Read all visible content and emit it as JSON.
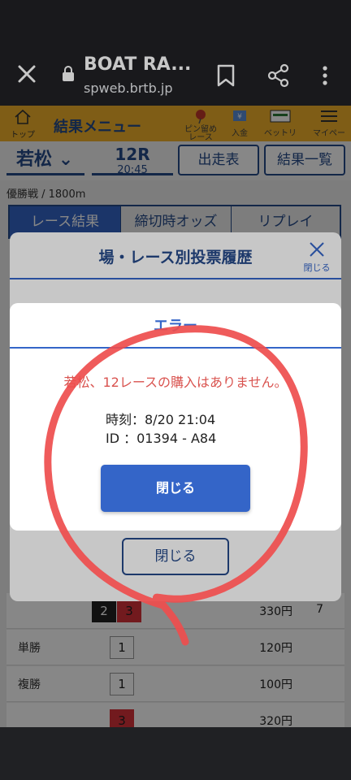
{
  "browser": {
    "title": "BOAT RA...",
    "domain": "spweb.brtb.jp"
  },
  "header": {
    "home_label": "トップ",
    "menu_title": "結果メニュー",
    "items": [
      {
        "label": "ピン留め\nレース",
        "icon": "pin-icon"
      },
      {
        "label": "入金",
        "icon": "deposit-icon"
      },
      {
        "label": "ベットリスト",
        "icon": "betlist-icon"
      },
      {
        "label": "マイページ",
        "icon": "menu-icon"
      }
    ]
  },
  "venue": {
    "name": "若松",
    "race": "12R",
    "time": "20:45",
    "tabs": [
      "出走表",
      "結果一覧"
    ]
  },
  "race_info": "優勝戦 / 1800m",
  "result_tabs": [
    "レース結果",
    "締切時オッズ",
    "リプレイ"
  ],
  "results": [
    {
      "label": "",
      "boats": [
        "2",
        "3"
      ],
      "amount": "330円",
      "popularity": "7"
    },
    {
      "label": "単勝",
      "boats": [
        "1"
      ],
      "amount": "120円",
      "popularity": ""
    },
    {
      "label": "複勝",
      "boats": [
        "1"
      ],
      "amount": "100円",
      "popularity": ""
    },
    {
      "label": "",
      "boats": [
        "3"
      ],
      "amount": "320円",
      "popularity": ""
    }
  ],
  "history_modal": {
    "title": "場・レース別投票履歴",
    "close_label": "閉じる",
    "bottom_button": "閉じる"
  },
  "error_modal": {
    "title": "エラー",
    "message": "若松、12レースの購入はありません。",
    "time_line": "時刻：8/20 21:04",
    "id_line": "ID ：01394 - A84",
    "button": "閉じる"
  },
  "colors": {
    "brand_blue": "#264a8a",
    "accent_blue": "#3465c8",
    "header_orange": "#f1b22b",
    "error_red": "#d9534f",
    "annotation_red": "#ee4d4d"
  }
}
